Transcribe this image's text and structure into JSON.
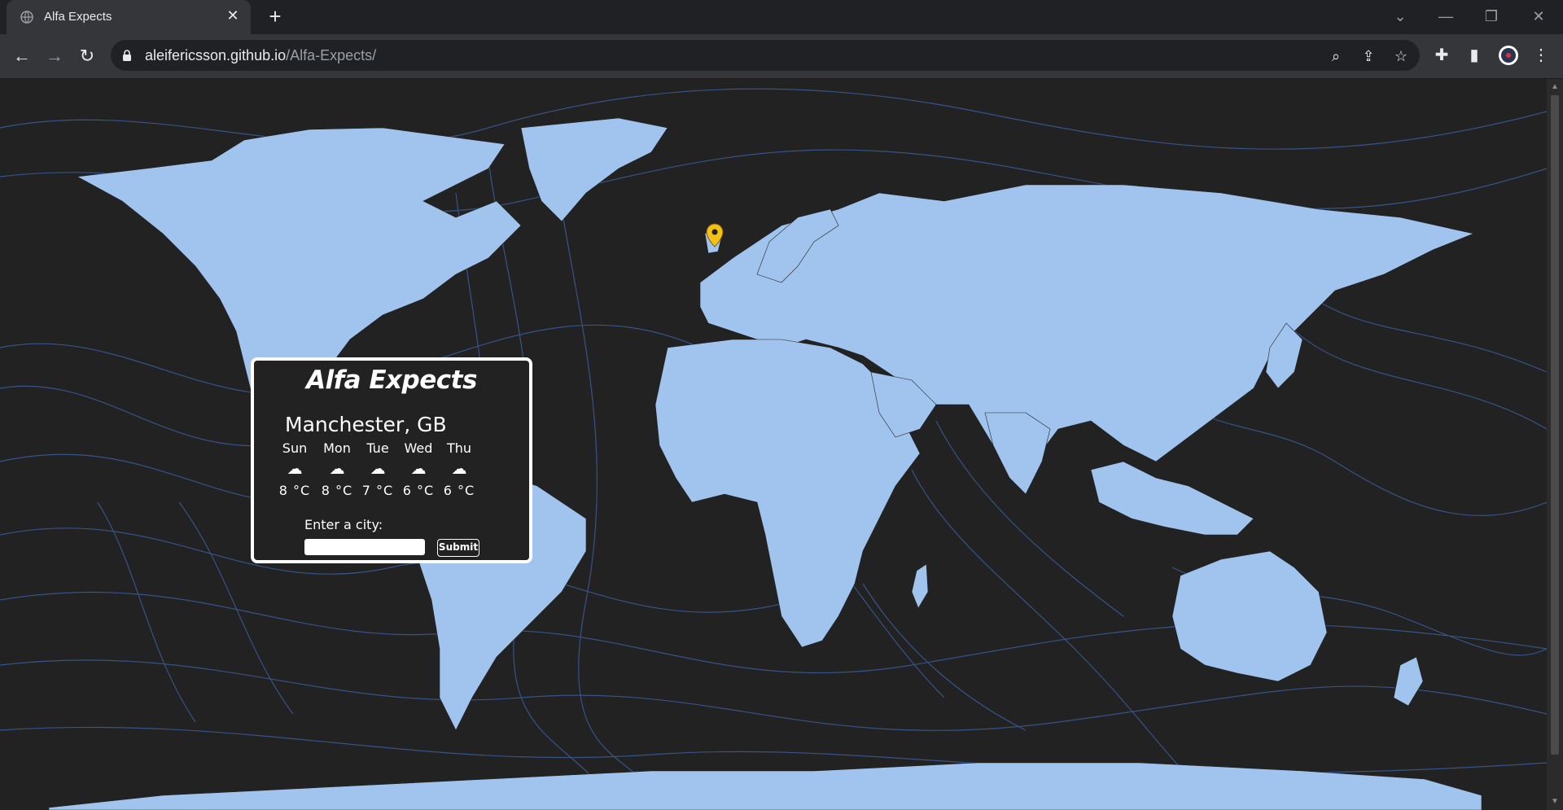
{
  "browser": {
    "tab_title": "Alfa Expects",
    "tab_close": "✕",
    "new_tab": "+",
    "url_host": "aleifericsson.github.io",
    "url_path": "/Alfa-Expects/"
  },
  "app": {
    "title": "Alfa Expects",
    "location": "Manchester, GB",
    "forecast": [
      {
        "day": "Sun",
        "temp": "8 °C",
        "icon": "cloud-icon"
      },
      {
        "day": "Mon",
        "temp": "8 °C",
        "icon": "cloud-icon"
      },
      {
        "day": "Tue",
        "temp": "7 °C",
        "icon": "cloud-icon"
      },
      {
        "day": "Wed",
        "temp": "6 °C",
        "icon": "cloud-icon"
      },
      {
        "day": "Thu",
        "temp": "6 °C",
        "icon": "cloud-icon"
      }
    ],
    "city_prompt": "Enter a city:",
    "city_value": "",
    "submit_label": "Submit"
  },
  "colors": {
    "land": "#a0c4ee",
    "ocean": "#222222",
    "wind_lines": "#3b5c99",
    "marker": "#f3c21a"
  }
}
